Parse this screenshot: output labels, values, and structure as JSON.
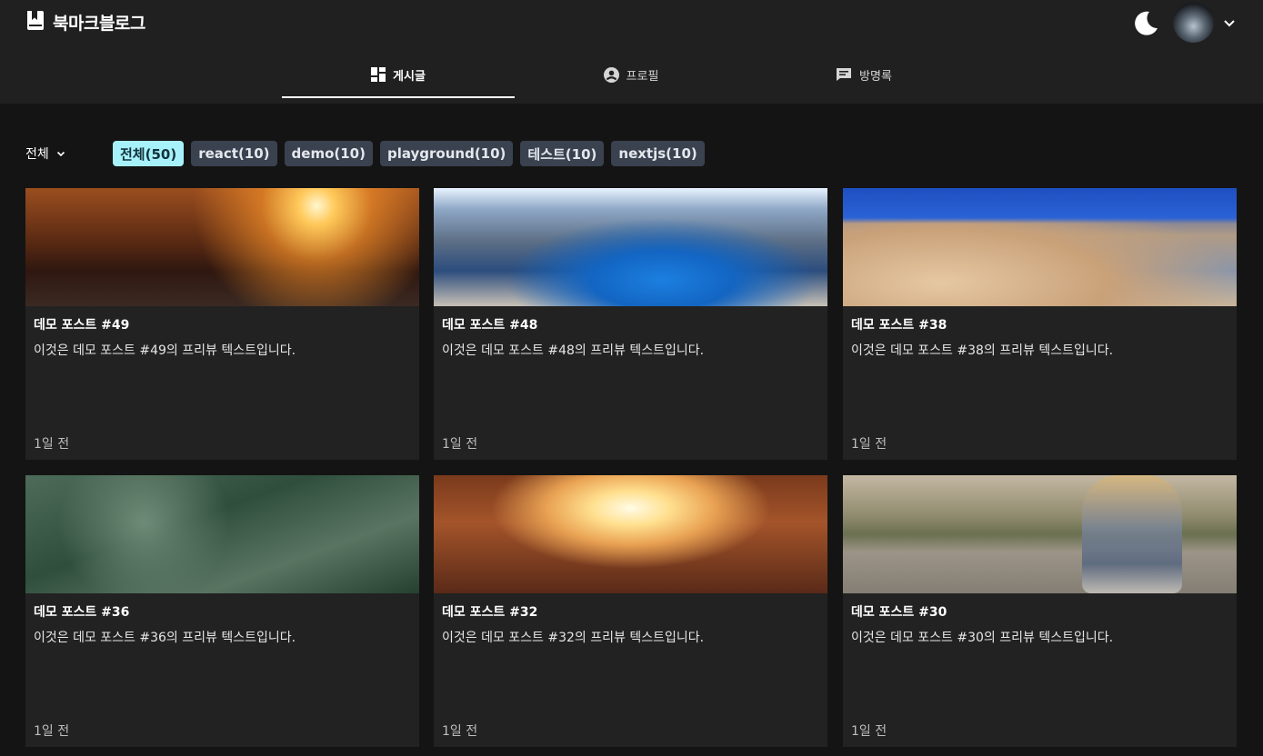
{
  "header": {
    "brand": "북마크블로그",
    "icons": {
      "logo": "bookmark-book-icon",
      "theme": "moon-icon",
      "menu": "chevron-down-icon"
    }
  },
  "tabs": [
    {
      "label": "게시글",
      "icon": "dashboard-icon",
      "active": true
    },
    {
      "label": "프로필",
      "icon": "account-circle-icon",
      "active": false
    },
    {
      "label": "방명록",
      "icon": "comment-icon",
      "active": false
    }
  ],
  "filter": {
    "category_label": "전체",
    "chips": [
      {
        "label": "전체(50)",
        "active": true
      },
      {
        "label": "react(10)",
        "active": false
      },
      {
        "label": "demo(10)",
        "active": false
      },
      {
        "label": "playground(10)",
        "active": false
      },
      {
        "label": "테스트(10)",
        "active": false
      },
      {
        "label": "nextjs(10)",
        "active": false
      }
    ]
  },
  "posts": [
    {
      "title": "데모 포스트 #49",
      "desc": "이것은 데모 포스트 #49의 프리뷰 텍스트입니다.",
      "time": "1일 전"
    },
    {
      "title": "데모 포스트 #48",
      "desc": "이것은 데모 포스트 #48의 프리뷰 텍스트입니다.",
      "time": "1일 전"
    },
    {
      "title": "데모 포스트 #38",
      "desc": "이것은 데모 포스트 #38의 프리뷰 텍스트입니다.",
      "time": "1일 전"
    },
    {
      "title": "데모 포스트 #36",
      "desc": "이것은 데모 포스트 #36의 프리뷰 텍스트입니다.",
      "time": "1일 전"
    },
    {
      "title": "데모 포스트 #32",
      "desc": "이것은 데모 포스트 #32의 프리뷰 텍스트입니다.",
      "time": "1일 전"
    },
    {
      "title": "데모 포스트 #30",
      "desc": "이것은 데모 포스트 #30의 프리뷰 텍스트입니다.",
      "time": "1일 전"
    }
  ],
  "colors": {
    "background": "#141414",
    "header": "#202020",
    "card": "#222222",
    "chip": "#3a4250",
    "chip_active": "#a7f1fb"
  }
}
